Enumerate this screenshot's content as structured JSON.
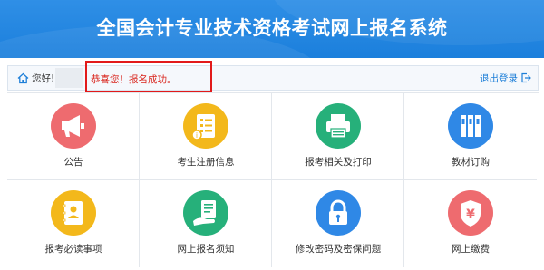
{
  "header": {
    "title": "全国会计专业技术资格考试网上报名系统"
  },
  "bar": {
    "greeting": "您好!",
    "logout": "退出登录"
  },
  "notice": {
    "message": "恭喜您！报名成功。"
  },
  "menu": [
    {
      "label": "公告",
      "color": "#ee6b6f",
      "icon": "megaphone-icon"
    },
    {
      "label": "考生注册信息",
      "color": "#f3b81b",
      "icon": "registration-form-icon"
    },
    {
      "label": "报考相关及打印",
      "color": "#26b07a",
      "icon": "printer-icon"
    },
    {
      "label": "教材订购",
      "color": "#2f88e6",
      "icon": "books-icon"
    },
    {
      "label": "报考必读事项",
      "color": "#f3b81b",
      "icon": "notebook-icon"
    },
    {
      "label": "网上报名须知",
      "color": "#26b07a",
      "icon": "online-signup-icon"
    },
    {
      "label": "修改密码及密保问题",
      "color": "#2f88e6",
      "icon": "lock-icon"
    },
    {
      "label": "网上缴费",
      "color": "#ee6b6f",
      "icon": "payment-shield-icon"
    }
  ]
}
